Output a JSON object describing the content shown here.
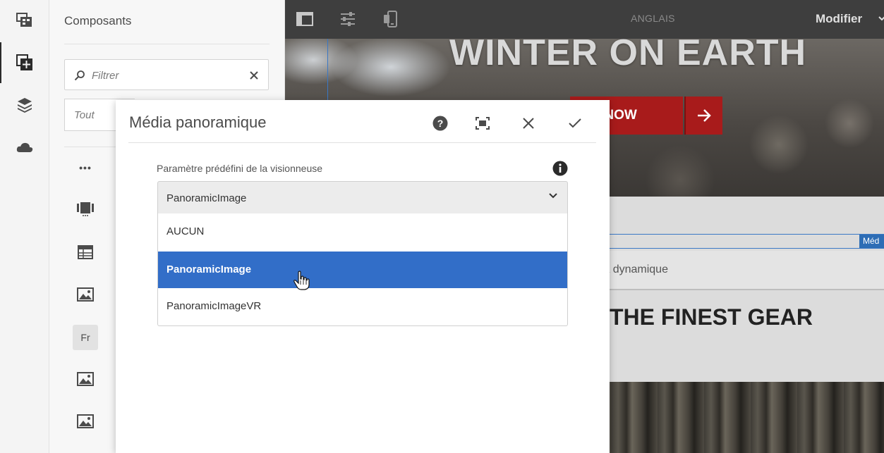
{
  "panel": {
    "title": "Composants",
    "filter_placeholder": "Filtrer",
    "group_value": "Tout",
    "more_label": "•••",
    "text_component_abbr": "Fr"
  },
  "topbar": {
    "language": "ANGLAIS",
    "mode_label": "Modifier"
  },
  "page": {
    "hero_title": "WINTER ON EARTH",
    "hero_button": "OP NOW",
    "media_tag": "Méd",
    "dynamic_media_label": "édia dynamique",
    "section_heading": "THE FINEST GEAR"
  },
  "dialog": {
    "title": "Média panoramique",
    "field_label": "Paramètre prédéfini de la visionneuse",
    "selected_value": "PanoramicImage",
    "options": [
      "AUCUN",
      "PanoramicImage",
      "PanoramicImageVR"
    ],
    "highlighted_index": 1
  },
  "colors": {
    "accent_blue": "#326ec8",
    "topbar_bg": "#3e3e3e",
    "brand_red": "#a81b1b"
  },
  "icons": {
    "rail": [
      "assets-icon",
      "components-icon",
      "layers-icon",
      "cloud-icon"
    ],
    "topbar": [
      "side-panel-icon",
      "properties-icon",
      "emulator-icon"
    ],
    "components": [
      "more-icon",
      "carousel-icon",
      "table-icon",
      "image-icon",
      "text-icon",
      "image-icon",
      "image-icon"
    ],
    "dialog": [
      "help-icon",
      "fullscreen-icon",
      "close-icon",
      "done-icon",
      "info-icon",
      "chevron-down-icon",
      "hand-cursor-icon"
    ]
  }
}
